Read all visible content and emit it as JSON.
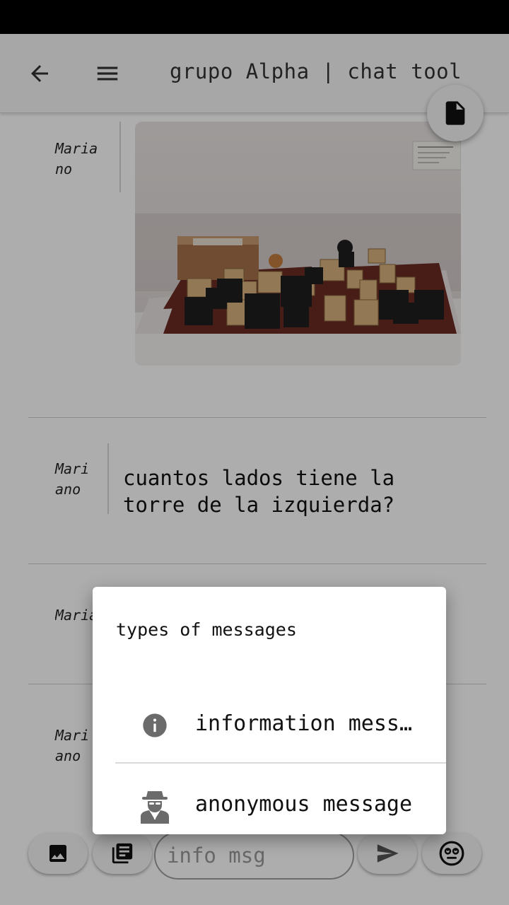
{
  "app_bar": {
    "title": "grupo Alpha | chat tool",
    "back_icon": "arrow-back-icon",
    "menu_icon": "hamburger-menu-icon",
    "file_icon": "document-icon"
  },
  "messages": [
    {
      "author": "Mariano",
      "type": "image",
      "image": "photo of wooden chess pieces in a display case"
    },
    {
      "author": "Mariano",
      "type": "text",
      "text": "cuantos lados tiene la torre de la izquierda?"
    },
    {
      "author": "Mariano",
      "type": "text",
      "text": ""
    },
    {
      "author": "Mariano",
      "type": "text",
      "text": ""
    }
  ],
  "composer": {
    "placeholder": "info msg",
    "value": "",
    "image_icon": "image-icon",
    "gallery_icon": "photo-library-icon",
    "send_icon": "send-icon",
    "emoji_icon": "emoji-face-icon"
  },
  "dialog": {
    "title": "types of messages",
    "items": [
      {
        "label": "information message",
        "icon": "info-icon"
      },
      {
        "label": "anonymous message",
        "icon": "incognito-spy-icon"
      }
    ]
  },
  "colors": {
    "status_bar": "#000000",
    "app_bar": "#f7f7f7",
    "scrim": "rgba(0,0,0,0.32)",
    "icon": "#333333"
  }
}
